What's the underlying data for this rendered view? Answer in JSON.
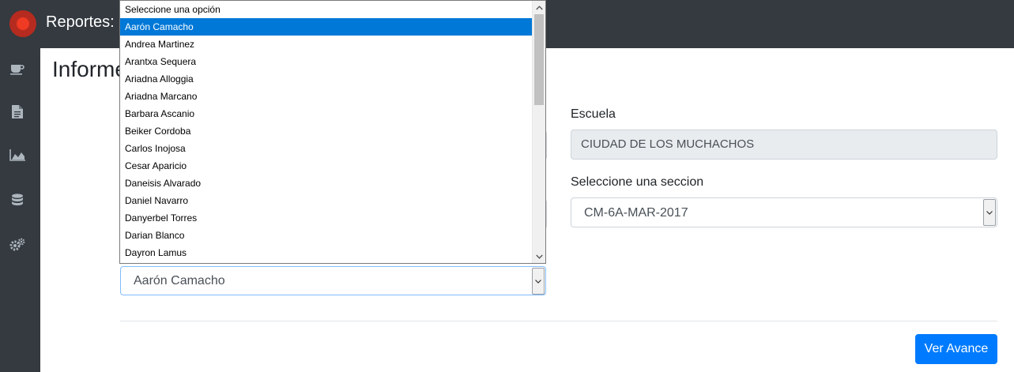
{
  "app": {
    "title": "Reportes: P"
  },
  "page": {
    "title": "Informe"
  },
  "sidebar": {
    "icons": [
      {
        "name": "coffee-icon"
      },
      {
        "name": "document-icon"
      },
      {
        "name": "area-chart-icon"
      },
      {
        "name": "database-icon"
      },
      {
        "name": "gears-icon"
      }
    ]
  },
  "form": {
    "school_label": "Escuela",
    "school_value": "CIUDAD DE LOS MUCHACHOS",
    "section_label": "Seleccione una seccion",
    "section_value": "CM-6A-MAR-2017",
    "student_value": "Aarón Camacho",
    "submit_label": "Ver Avance"
  },
  "dropdown": {
    "options": [
      "Seleccione una opción",
      "Aarón Camacho",
      "Andrea Martinez",
      "Arantxa Sequera",
      "Ariadna Alloggia",
      "Ariadna Marcano",
      "Barbara Ascanio",
      "Beiker Cordoba",
      "Carlos Inojosa",
      "Cesar Aparicio",
      "Daneisis Alvarado",
      "Daniel Navarro",
      "Danyerbel Torres",
      "Darian Blanco",
      "Dayron Lamus"
    ],
    "selected_index": 1
  },
  "colors": {
    "topbar": "#343a40",
    "primary": "#007bff",
    "highlight": "#0078d7"
  }
}
